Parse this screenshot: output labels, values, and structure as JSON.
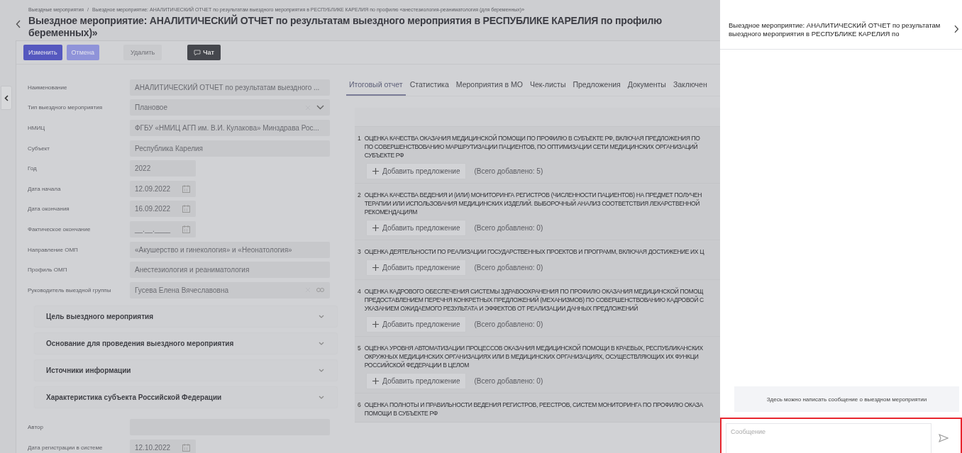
{
  "breadcrumb": {
    "parent": "Выездные мероприятия",
    "separator": "/",
    "current": "Выездное мероприятие: АНАЛИТИЧЕСКИЙ ОТЧЕТ по результатам выездного мероприятия в РЕСПУБЛИКЕ КАРЕЛИЯ по профилю «анестезиология-реаниматология (для беременных)»"
  },
  "title_lines": [
    "Выездное мероприятие: АНАЛИТИЧЕСКИЙ ОТЧЕТ по результатам выездного мероприятия в РЕСПУБЛИКЕ КАРЕЛИЯ по профилю",
    "беременных)»"
  ],
  "toolbar": [
    {
      "label": "Изменить",
      "kind": "primary"
    },
    {
      "label": "Отмена",
      "kind": "secondary"
    },
    {
      "label": "Удалить",
      "kind": "disabled"
    },
    {
      "label": "Чат",
      "kind": "chat"
    }
  ],
  "form": [
    {
      "label": "Наименование",
      "kind": "text",
      "value": "АНАЛИТИЧЕСКИЙ ОТЧЕТ по результатам выездного ..."
    },
    {
      "label": "Тип выездного мероприятия",
      "kind": "select",
      "value": "Плановое"
    },
    {
      "label": "НМИЦ",
      "kind": "text",
      "value": "ФГБУ «НМИЦ АГП им. В.И. Кулакова» Минздрава Рос..."
    },
    {
      "label": "Субъект",
      "kind": "text",
      "value": "Республика Карелия"
    },
    {
      "label": "Год",
      "kind": "short",
      "value": "2022"
    },
    {
      "label": "Дата начала",
      "kind": "date",
      "value": "12.09.2022"
    },
    {
      "label": "Дата окончания",
      "kind": "date",
      "value": "16.09.2022"
    },
    {
      "label": "Фактическое окончание",
      "kind": "date",
      "value": "__.__.____"
    },
    {
      "label": "Направление ОМП",
      "kind": "text",
      "value": "«Акушерство и гинекология» и «Неонатология»"
    },
    {
      "label": "Профиль ОМП",
      "kind": "text",
      "value": "Анестезиология и реаниматология"
    },
    {
      "label": "Руководитель выездной группы",
      "kind": "lookup",
      "value": "Гусева Елена Вячеславовна"
    }
  ],
  "sections": [
    {
      "title": "Цель выездного мероприятия",
      "expanded": false
    },
    {
      "title": "Основание для проведения выездного мероприятия",
      "expanded": false
    },
    {
      "title": "Источники информации",
      "expanded": false
    },
    {
      "title": "Характеристика субъекта Российской Федерации",
      "expanded": false
    }
  ],
  "form_bottom": [
    {
      "label": "Автор",
      "kind": "text"
    },
    {
      "label": "Дата регистрации в системе",
      "kind": "date",
      "value": "12.10.2022"
    }
  ],
  "tabs": [
    {
      "label": "Итоговый отчет",
      "selected": true
    },
    {
      "label": "Статистика",
      "selected": false
    },
    {
      "label": "Мероприятия в МО",
      "selected": false
    },
    {
      "label": "Чек-листы",
      "selected": false
    },
    {
      "label": "Предложения",
      "selected": false
    },
    {
      "label": "Документы",
      "selected": false
    },
    {
      "label": "Заключен",
      "selected": false
    }
  ],
  "report_items": [
    {
      "number": "1",
      "lines": [
        "ОЦЕНКА КАЧЕСТВА ОКАЗАНИЯ МЕДИЦИНСКОЙ ПОМОЩИ ПО ПРОФИЛЮ В СУБЪЕКТЕ РФ, ВКЛЮЧАЯ ПРЕДЛОЖЕНИЯ ПО",
        "ПО СОВЕРШЕНСТВОВАНИЮ МАРШРУТИЗАЦИИ ПАЦИЕНТОВ, ПО ОПТИМИЗАЦИИ СЕТИ МЕДИЦИНСКИХ ОРГАНИЗАЦИЙ",
        "СУБЪЕКТЕ РФ"
      ],
      "add_button": "Добавить предложение",
      "count": "(Всего добавлено: 5)"
    },
    {
      "number": "2",
      "lines": [
        "ОЦЕНКА КАЧЕСТВА ВЕДЕНИЯ И (ИЛИ) МОНИТОРИНГА РЕГИСТРОВ (ЧИСЛЕННОСТИ ПАЦИЕНТОВ) НА ПРЕДМЕТ ПОЛУЧЕН",
        "ТЕРАПИИ ИЛИ ИСПОЛЬЗОВАНИЯ МЕДИЦИНСКИХ ИЗДЕЛИЙ. ВЫБОРОЧНЫЙ АНАЛИЗ СООТВЕТСТВИЯ ЛЕКАРСТВЕННОЙ",
        "РЕКОМЕНДАЦИЯМ"
      ],
      "add_button": "Добавить предложение",
      "count": "(Всего добавлено: 0)"
    },
    {
      "number": "3",
      "lines": [
        "ОЦЕНКА ДЕЯТЕЛЬНОСТИ ПО РЕАЛИЗАЦИИ ГОСУДАРСТВЕННЫХ ПРОЕКТОВ И ПРОГРАММ, ВКЛЮЧАЯ ДОСТИЖЕНИЕ ИХ Ц"
      ],
      "add_button": "Добавить предложение",
      "count": "(Всего добавлено: 0)"
    },
    {
      "number": "4",
      "lines": [
        "ОЦЕНКА КАДРОВОГО ОБЕСПЕЧЕНИЯ СИСТЕМЫ ЗДРАВООХРАНЕНИЯ ПО ПРОФИЛЮ ОКАЗАНИЯ МЕДИЦИНСКОЙ ПОМОЩ",
        "ПРЕДОСТАВЛЕНИЕМ ПЕРЕЧНЯ КОНКРЕТНЫХ ПРЕДЛОЖЕНИЙ (МЕХАНИЗМОВ) ПО СОВЕРШЕНСТВОВАНИЮ КАДРОВОЙ С",
        "УКАЗАНИЕМ ОЖИДАЕМОГО РЕЗУЛЬТАТА И ЭФФЕКТОВ ОТ РЕАЛИЗАЦИИ ДАННЫХ ПРЕДЛОЖЕНИЙ"
      ],
      "add_button": "Добавить предложение",
      "count": "(Всего добавлено: 0)"
    },
    {
      "number": "5",
      "lines": [
        "ОЦЕНКА УРОВНЯ АВТОМАТИЗАЦИИ ПРОЦЕССОВ ОКАЗАНИЯ МЕДИЦИНСКОЙ ПОМОЩИ В КРАЕВЫХ, РЕСПУБЛИКАНСКИХ",
        "ОКРУЖНЫХ МЕДИЦИНСКИХ ОРГАНИЗАЦИЯХ ИЛИ В МЕДИЦИНСКИХ ОРГАНИЗАЦИЯХ, ОСУЩЕСТВЛЯЮЩИХ ИХ ФУНКЦИ",
        "РОССИЙСКОЙ ФЕДЕРАЦИИ В ЦЕЛОМ"
      ],
      "add_button": "Добавить предложение",
      "count": "(Всего добавлено: 0)"
    },
    {
      "number": "6",
      "lines": [
        "ОЦЕНКА ПОЛНОТЫ И ПРАВИЛЬНОСТИ ВЕДЕНИЯ РЕГИСТРОВ, РЕЕСТРОВ, СИСТЕМ МОНИТОРИНГА ПО ПРОФИЛЮ ОКАЗА",
        "ПОМОЩИ В СУБЪЕКТЕ РФ"
      ]
    }
  ],
  "chat": {
    "title": "Выездное мероприятие: АНАЛИТИЧЕСКИЙ ОТЧЕТ по результатам выездного мероприятия в РЕСПУБЛИКЕ КАРЕЛИЯ по",
    "hint": "Здесь можно написать сообщение о выездном мероприятии",
    "input": {
      "placeholder": "Сообщение"
    }
  }
}
